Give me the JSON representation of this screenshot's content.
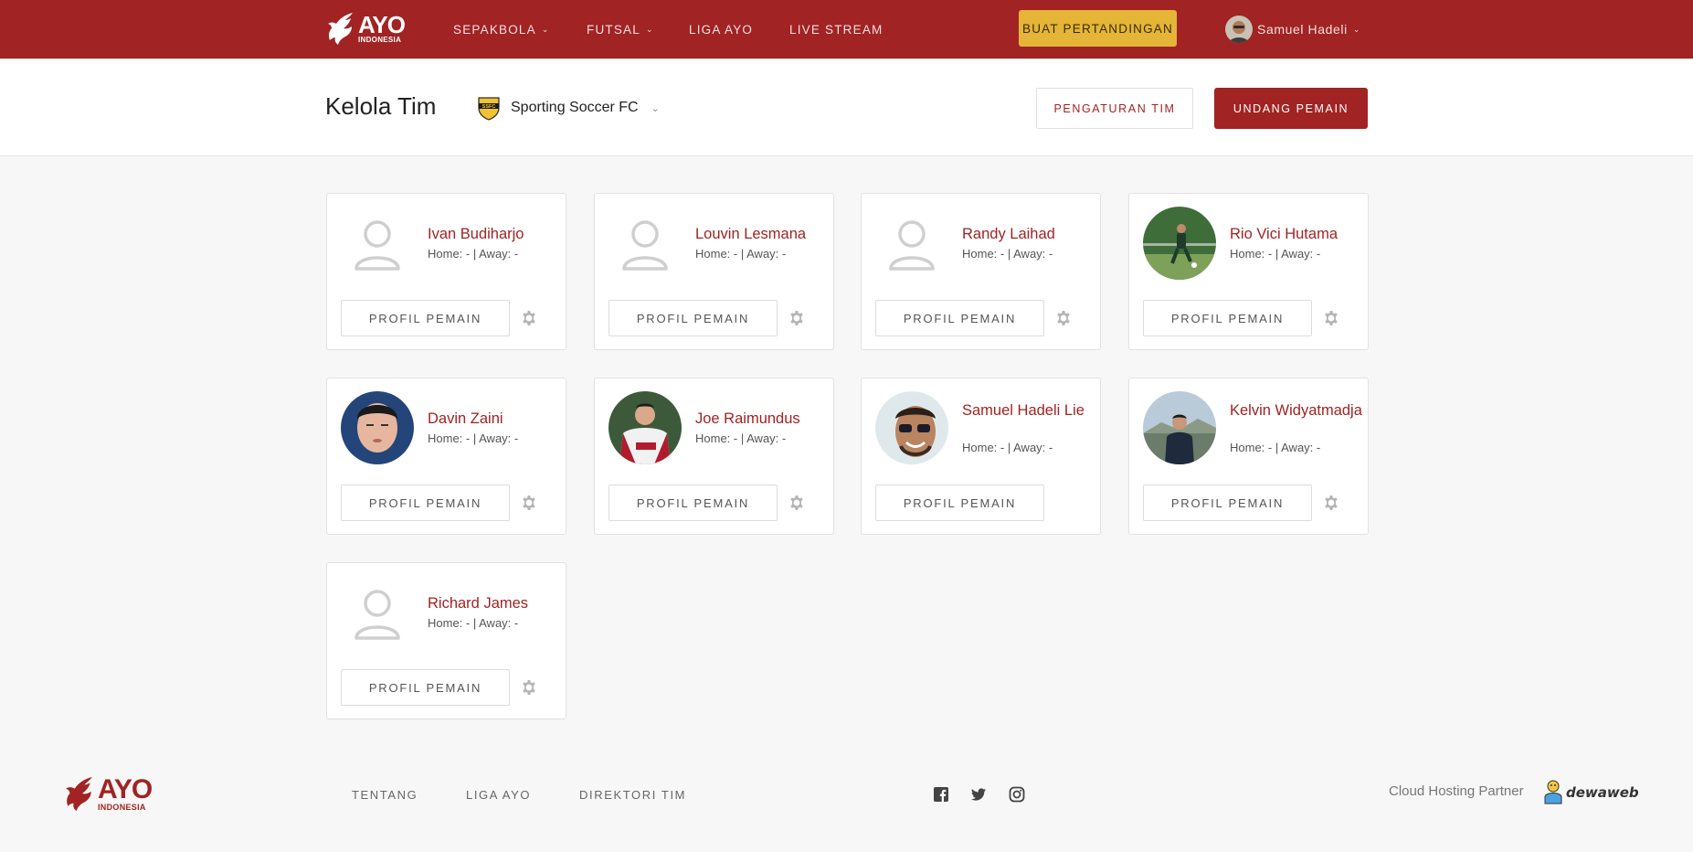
{
  "topbar": {
    "logo": {
      "brand": "AYO",
      "sub": "INDONESIA"
    },
    "nav": [
      {
        "label": "SEPAKBOLA",
        "dropdown": true
      },
      {
        "label": "FUTSAL",
        "dropdown": true
      },
      {
        "label": "LIGA AYO",
        "dropdown": false
      },
      {
        "label": "LIVE STREAM",
        "dropdown": false
      }
    ],
    "cta_label": "BUAT PERTANDINGAN",
    "user_name": "Samuel Hadeli"
  },
  "subheader": {
    "title": "Kelola Tim",
    "team_name": "Sporting Soccer FC",
    "team_logo_text": "SSFC",
    "settings_label": "PENGATURAN TIM",
    "invite_label": "UNDANG PEMAIN"
  },
  "players": [
    {
      "name": "Ivan Budiharjo",
      "stats": "Home: - | Away: -",
      "photo": "placeholder",
      "profile_label": "PROFIL PEMAIN",
      "has_settings": true
    },
    {
      "name": "Louvin Lesmana",
      "stats": "Home: - | Away: -",
      "photo": "placeholder",
      "profile_label": "PROFIL PEMAIN",
      "has_settings": true
    },
    {
      "name": "Randy Laihad",
      "stats": "Home: - | Away: -",
      "photo": "placeholder",
      "profile_label": "PROFIL PEMAIN",
      "has_settings": true
    },
    {
      "name": "Rio Vici Hutama",
      "stats": "Home: - | Away: -",
      "photo": "field",
      "profile_label": "PROFIL PEMAIN",
      "has_settings": true
    },
    {
      "name": "Davin Zaini",
      "stats": "Home: - | Away: -",
      "photo": "face-blue",
      "profile_label": "PROFIL PEMAIN",
      "has_settings": true
    },
    {
      "name": "Joe Raimundus",
      "stats": "Home: - | Away: -",
      "photo": "jersey",
      "profile_label": "PROFIL PEMAIN",
      "has_settings": true
    },
    {
      "name": "Samuel Hadeli Lie",
      "stats": "Home: - | Away: -",
      "photo": "sunglasses",
      "profile_label": "PROFIL PEMAIN",
      "has_settings": false
    },
    {
      "name": "Kelvin Widyatmadja",
      "stats": "Home: - | Away: -",
      "photo": "outdoor",
      "profile_label": "PROFIL PEMAIN",
      "has_settings": true
    },
    {
      "name": "Richard James",
      "stats": "Home: - | Away: -",
      "photo": "placeholder",
      "profile_label": "PROFIL PEMAIN",
      "has_settings": true
    }
  ],
  "footer": {
    "links": [
      "TENTANG",
      "LIGA AYO",
      "DIREKTORI TIM"
    ],
    "social": [
      "facebook-icon",
      "twitter-icon",
      "instagram-icon"
    ],
    "partner_label": "Cloud Hosting Partner",
    "partner_name": "dewaweb"
  },
  "colors": {
    "brand": "#a12323",
    "cta": "#e4b536"
  }
}
